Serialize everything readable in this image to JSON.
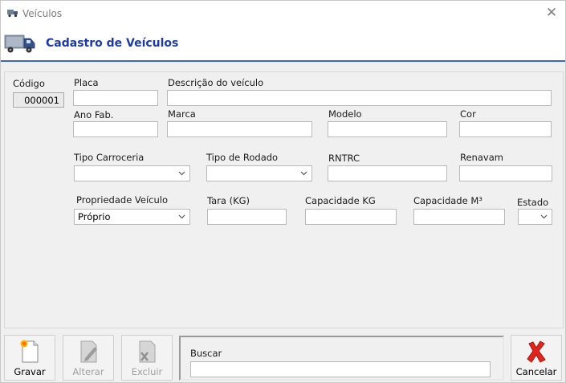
{
  "window": {
    "title": "Veículos"
  },
  "header": {
    "title": "Cadastro de Veículos"
  },
  "form": {
    "codigo": {
      "label": "Código",
      "value": "000001"
    },
    "placa": {
      "label": "Placa",
      "value": ""
    },
    "descricao": {
      "label": "Descrição do veículo",
      "value": ""
    },
    "ano_fab": {
      "label": "Ano Fab.",
      "value": ""
    },
    "marca": {
      "label": "Marca",
      "value": ""
    },
    "modelo": {
      "label": "Modelo",
      "value": ""
    },
    "cor": {
      "label": "Cor",
      "value": ""
    },
    "tipo_carroceria": {
      "label": "Tipo Carroceria",
      "value": ""
    },
    "tipo_rodado": {
      "label": "Tipo de Rodado",
      "value": ""
    },
    "rntrc": {
      "label": "RNTRC",
      "value": ""
    },
    "renavam": {
      "label": "Renavam",
      "value": ""
    },
    "propriedade": {
      "label": "Propriedade Veículo",
      "value": "Próprio"
    },
    "tara": {
      "label": "Tara (KG)",
      "value": ""
    },
    "capacidade_kg": {
      "label": "Capacidade KG",
      "value": ""
    },
    "capacidade_m3": {
      "label": "Capacidade M³",
      "value": ""
    },
    "estado": {
      "label": "Estado",
      "value": ""
    }
  },
  "toolbar": {
    "gravar": "Gravar",
    "alterar": "Alterar",
    "excluir": "Excluir",
    "cancelar": "Cancelar"
  },
  "search": {
    "label": "Buscar",
    "value": ""
  },
  "icons": {
    "window": "truck-small-icon",
    "header": "truck-icon",
    "gravar": "new-document-icon",
    "alterar": "edit-document-icon",
    "excluir": "delete-document-icon",
    "cancelar": "red-x-icon"
  },
  "colors": {
    "header_title": "#1a3aa8",
    "header_border": "#3a66cc",
    "cancel_icon": "#e0261c"
  }
}
